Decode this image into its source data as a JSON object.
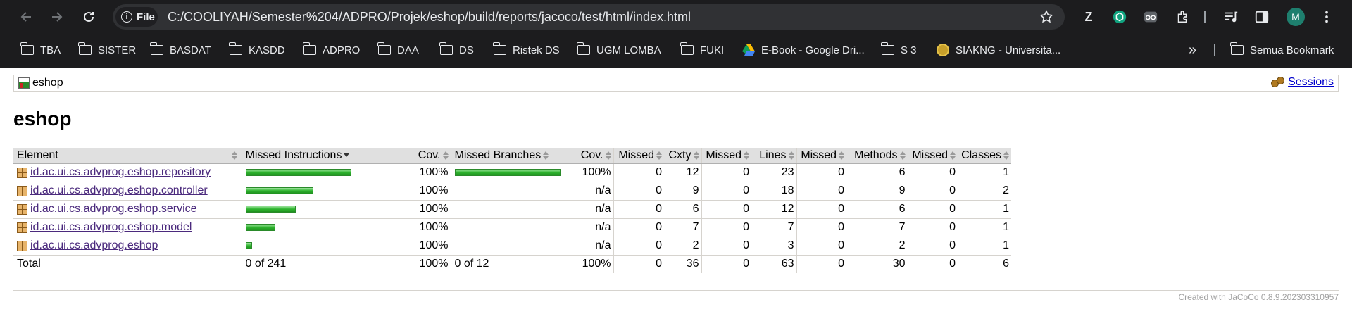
{
  "browser": {
    "chip_label": "File",
    "url": "C:/COOLIYAH/Semester%204/ADPRO/Projek/eshop/build/reports/jacoco/test/html/index.html",
    "avatar_letter": "M",
    "bookmarks": [
      "TBA",
      "SISTER",
      "BASDAT",
      "KASDD",
      "ADPRO",
      "DAA",
      "DS",
      "Ristek DS",
      "UGM LOMBA",
      "FUKI",
      "E-Book - Google Dri...",
      "S 3",
      "SIAKNG - Universita..."
    ],
    "overflow": "»",
    "all_bookmarks": "Semua Bookmark"
  },
  "report": {
    "breadcrumb": "eshop",
    "sessions_link": "Sessions",
    "title": "eshop",
    "headers": [
      "Element",
      "Missed Instructions",
      "Cov.",
      "Missed Branches",
      "Cov.",
      "Missed",
      "Cxty",
      "Missed",
      "Lines",
      "Missed",
      "Methods",
      "Missed",
      "Classes"
    ],
    "rows": [
      {
        "name": "id.ac.ui.cs.advprog.eshop.repository",
        "instr_covered_fraction": 1.0,
        "instr_bar_fraction": 1.0,
        "instr_cov": "100%",
        "branch_bar_fraction": 1.0,
        "branch_cov": "100%",
        "missed_cxty": "0",
        "cxty": "12",
        "missed_lines": "0",
        "lines": "23",
        "missed_methods": "0",
        "methods": "6",
        "missed_classes": "0",
        "classes": "1"
      },
      {
        "name": "id.ac.ui.cs.advprog.eshop.controller",
        "instr_bar_fraction": 0.64,
        "instr_cov": "100%",
        "branch_bar_fraction": 0,
        "branch_cov": "n/a",
        "missed_cxty": "0",
        "cxty": "9",
        "missed_lines": "0",
        "lines": "18",
        "missed_methods": "0",
        "methods": "9",
        "missed_classes": "0",
        "classes": "2"
      },
      {
        "name": "id.ac.ui.cs.advprog.eshop.service",
        "instr_bar_fraction": 0.47,
        "instr_cov": "100%",
        "branch_bar_fraction": 0,
        "branch_cov": "n/a",
        "missed_cxty": "0",
        "cxty": "6",
        "missed_lines": "0",
        "lines": "12",
        "missed_methods": "0",
        "methods": "6",
        "missed_classes": "0",
        "classes": "1"
      },
      {
        "name": "id.ac.ui.cs.advprog.eshop.model",
        "instr_bar_fraction": 0.28,
        "instr_cov": "100%",
        "branch_bar_fraction": 0,
        "branch_cov": "n/a",
        "missed_cxty": "0",
        "cxty": "7",
        "missed_lines": "0",
        "lines": "7",
        "missed_methods": "0",
        "methods": "7",
        "missed_classes": "0",
        "classes": "1"
      },
      {
        "name": "id.ac.ui.cs.advprog.eshop",
        "instr_bar_fraction": 0.06,
        "instr_cov": "100%",
        "branch_bar_fraction": 0,
        "branch_cov": "n/a",
        "missed_cxty": "0",
        "cxty": "2",
        "missed_lines": "0",
        "lines": "3",
        "missed_methods": "0",
        "methods": "2",
        "missed_classes": "0",
        "classes": "1"
      }
    ],
    "total": {
      "label": "Total",
      "instr": "0 of 241",
      "instr_cov": "100%",
      "branch": "0 of 12",
      "branch_cov": "100%",
      "missed_cxty": "0",
      "cxty": "36",
      "missed_lines": "0",
      "lines": "63",
      "missed_methods": "0",
      "methods": "30",
      "missed_classes": "0",
      "classes": "6"
    },
    "footer_prefix": "Created with",
    "footer_link": "JaCoCo",
    "footer_version": "0.8.9.202303310957"
  }
}
